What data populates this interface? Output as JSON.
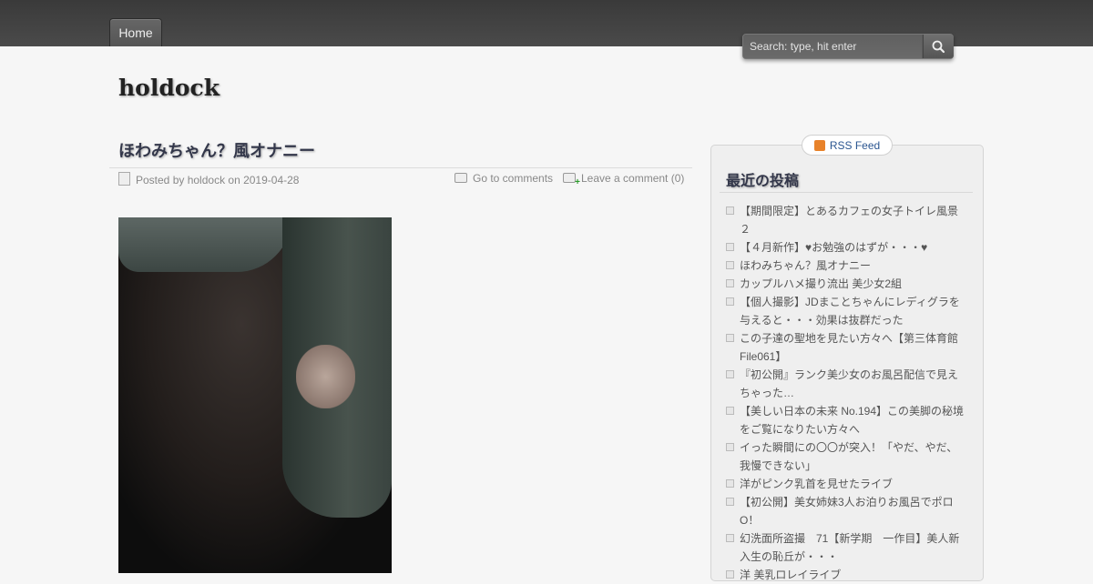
{
  "nav": {
    "home_label": "Home"
  },
  "search": {
    "placeholder": "Search: type, hit enter"
  },
  "site": {
    "title": "holdock"
  },
  "post": {
    "title": "ほわみちゃん？風オナニー",
    "meta": "Posted by holdock on 2019-04-28",
    "goto_comments": "Go to comments",
    "leave_comment": "Leave a comment (0)"
  },
  "sidebar": {
    "rss_label": "RSS Feed",
    "widget_title": "最近の投稿",
    "recent_posts": [
      "【期間限定】とあるカフェの女子トイレ風景２",
      "【４月新作】♥お勉強のはずが・・・♥",
      "ほわみちゃん？風オナニー",
      "カップルハメ撮り流出 美少女2組",
      "【個人撮影】JDまことちゃんにレディグラを与えると・・・効果は抜群だった",
      "この子達の聖地を見たい方々へ【第三体育館File061】",
      "『初公開』ランク美少女のお風呂配信で見えちゃった…",
      "【美しい日本の未来 No.194】この美脚の秘境をご覧になりたい方々へ",
      "イった瞬間にの〇〇が突入！「やだ、やだ、我慢できない」",
      "洋がピンク乳首を見せたライブ",
      "【初公開】美女姉妹3人お泊りお風呂でポロO！",
      "幻洗面所盗撮　71【新学期　一作目】美人新入生の恥丘が・・・",
      "洋 美乳ロレイライブ"
    ]
  }
}
